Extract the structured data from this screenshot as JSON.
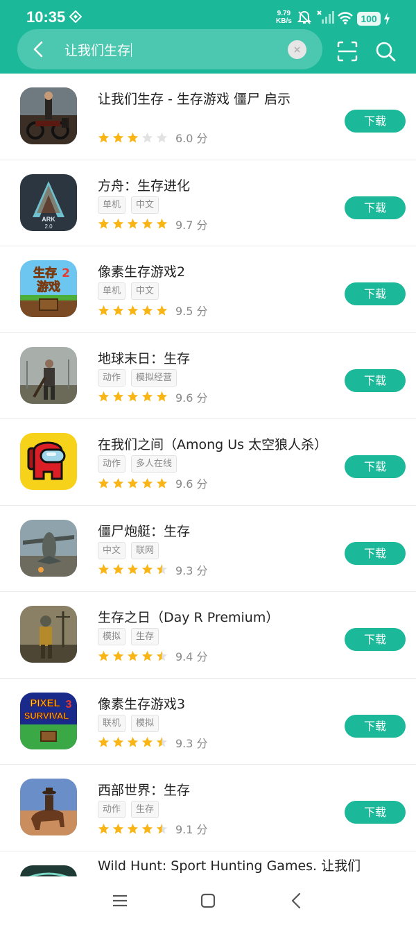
{
  "status": {
    "time": "10:35",
    "net_speed_value": "9.79",
    "net_speed_unit": "KB/s",
    "battery": "100"
  },
  "search": {
    "query": "让我们生存"
  },
  "list": {
    "download_label": "下载",
    "score_unit": "分",
    "apps": [
      {
        "name": "让我们生存 - 生存游戏 僵尸 启示",
        "tags": [],
        "rating": 3,
        "score": "6.0",
        "icon": "survivor-icon"
      },
      {
        "name": "方舟：生存进化",
        "tags": [
          "单机",
          "中文"
        ],
        "rating": 5,
        "score": "9.7",
        "icon": "ark-icon"
      },
      {
        "name": "像素生存游戏2",
        "tags": [
          "单机",
          "中文"
        ],
        "rating": 5,
        "score": "9.5",
        "icon": "pixel-survival-2-icon"
      },
      {
        "name": "地球末日：生存",
        "tags": [
          "动作",
          "模拟经营"
        ],
        "rating": 5,
        "score": "9.6",
        "icon": "last-day-on-earth-icon"
      },
      {
        "name": "在我们之间（Among Us 太空狼人杀）",
        "tags": [
          "动作",
          "多人在线"
        ],
        "rating": 5,
        "score": "9.6",
        "icon": "among-us-icon"
      },
      {
        "name": "僵尸炮艇：生存",
        "tags": [
          "中文",
          "联网"
        ],
        "rating": 4.5,
        "score": "9.3",
        "icon": "gunship-icon"
      },
      {
        "name": "生存之日（Day R Premium）",
        "tags": [
          "模拟",
          "生存"
        ],
        "rating": 4.5,
        "score": "9.4",
        "icon": "day-r-icon"
      },
      {
        "name": "像素生存游戏3",
        "tags": [
          "联机",
          "模拟"
        ],
        "rating": 4.5,
        "score": "9.3",
        "icon": "pixel-survival-3-icon"
      },
      {
        "name": "西部世界：生存",
        "tags": [
          "动作",
          "生存"
        ],
        "rating": 4.5,
        "score": "9.1",
        "icon": "westland-icon"
      }
    ],
    "partial": {
      "name": "Wild Hunt: Sport Hunting Games. 让我们"
    }
  },
  "icons": {
    "app_logo_text_1": "生存",
    "app_logo_num_1": "2",
    "app_logo_text_2": "游戏",
    "ark_text": "ARK",
    "ark_sub": "2.0",
    "pixel_text_1": "PIXEL",
    "pixel_text_2": "SURVIVAL",
    "pixel_num": "3"
  },
  "colors": {
    "accent": "#1bb99a",
    "star": "#f9b515",
    "star_empty": "#e2e2e2"
  }
}
